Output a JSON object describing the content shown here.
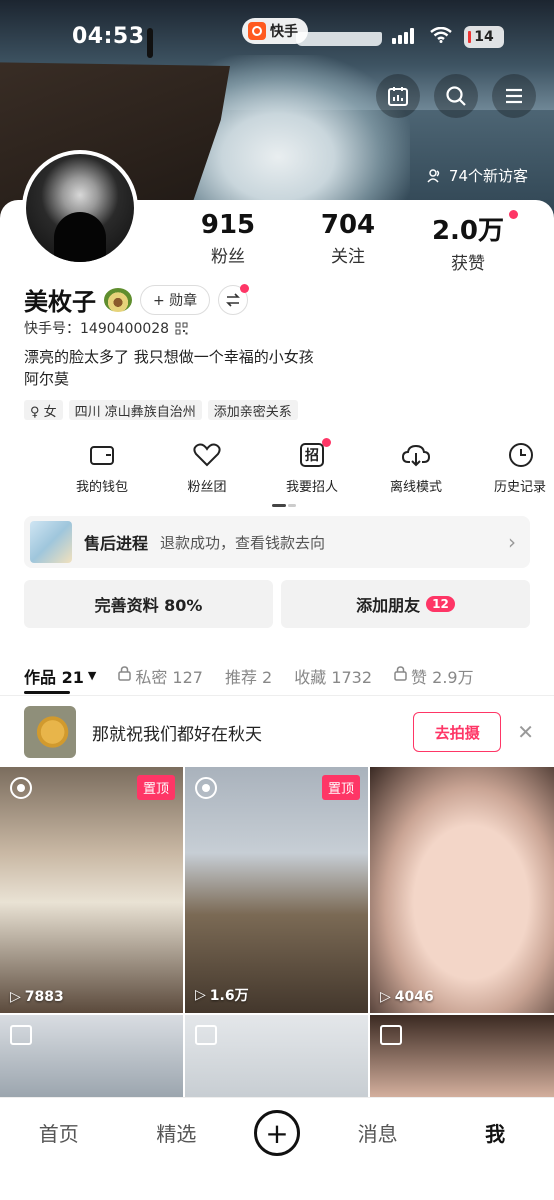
{
  "status_bar": {
    "time": "04:53",
    "app_name": "快手",
    "battery": "14"
  },
  "header": {
    "visitors": "74个新访客"
  },
  "stats": [
    {
      "value": "915",
      "label": "粉丝"
    },
    {
      "value": "704",
      "label": "关注"
    },
    {
      "value": "2.0万",
      "label": "获赞"
    }
  ],
  "profile": {
    "name": "美枚子",
    "badge_label": "+ 勋章",
    "kuaishou_id": "快手号：1490400028",
    "bio_line1": "漂亮的脸太多了 我只想做一个幸福的小女孩",
    "bio_line2": "阿尔莫",
    "tags": [
      "♀ 女",
      "四川 凉山彝族自治州",
      "添加亲密关系"
    ]
  },
  "tools": [
    {
      "label": "我的钱包",
      "icon": "wallet-icon"
    },
    {
      "label": "粉丝团",
      "icon": "heart-icon"
    },
    {
      "label": "我要招人",
      "icon": "recruit-icon"
    },
    {
      "label": "离线模式",
      "icon": "download-icon"
    },
    {
      "label": "历史记录",
      "icon": "clock-icon"
    }
  ],
  "after_sales": {
    "title": "售后进程",
    "desc": "退款成功，查看钱款去向"
  },
  "actions": {
    "complete_profile": "完善资料 80%",
    "add_friend": "添加朋友",
    "friend_count": "12"
  },
  "tabs": [
    {
      "label": "作品 21",
      "active": true
    },
    {
      "label": "私密 127"
    },
    {
      "label": "推荐 2"
    },
    {
      "label": "收藏 1732"
    },
    {
      "label": "赞 2.9万"
    }
  ],
  "promo": {
    "text": "那就祝我们都好在秋天",
    "button": "去拍摄"
  },
  "videos": [
    {
      "plays": "7883",
      "pinned": "置顶"
    },
    {
      "plays": "1.6万",
      "pinned": "置顶"
    },
    {
      "plays": "4046"
    }
  ],
  "bottom_nav": [
    "首页",
    "精选",
    "消息",
    "我"
  ],
  "colors": {
    "accent": "#fe3666"
  }
}
